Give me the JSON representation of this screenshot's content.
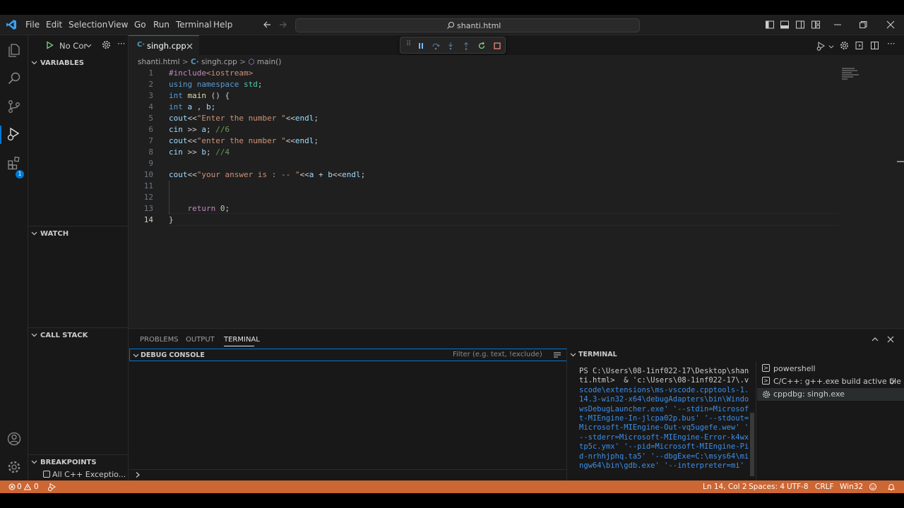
{
  "titlebar": {
    "menu": [
      "File",
      "Edit",
      "Selection",
      "View",
      "Go",
      "Run",
      "Terminal",
      "Help"
    ],
    "search_text": "shanti.html"
  },
  "sidebar": {
    "run_config": "No Cor",
    "sections": {
      "variables": "VARIABLES",
      "watch": "WATCH",
      "call_stack": "CALL STACK",
      "breakpoints": "BREAKPOINTS"
    },
    "breakpoint_item": "All C++ Exceptio...",
    "debug_badge": "1"
  },
  "editor": {
    "tab_label": "singh.cpp",
    "breadcrumb": {
      "folder": "shanti.html",
      "file": "singh.cpp",
      "symbol": "main()"
    },
    "line_numbers": [
      "1",
      "2",
      "3",
      "4",
      "5",
      "6",
      "7",
      "8",
      "9",
      "10",
      "11",
      "12",
      "13",
      "14"
    ],
    "current_line": "14"
  },
  "panel": {
    "tabs": [
      "PROBLEMS",
      "OUTPUT",
      "TERMINAL"
    ],
    "debug_console_title": "DEBUG CONSOLE",
    "filter_placeholder": "Filter (e.g. text, !exclude)",
    "terminal_title": "TERMINAL",
    "terminal_lines": [
      "PS C:\\Users\\08-1inf022-17\\Desktop\\shan",
      "ti.html>  & 'c:\\Users\\08-1inf022-17\\.v",
      "scode\\extensions\\ms-vscode.cpptools-1.",
      "14.3-win32-x64\\debugAdapters\\bin\\Windo",
      "wsDebugLauncher.exe' '--stdin=Microsof",
      "t-MIEngine-In-jlcpa02p.bus' '--stdout=",
      "Microsoft-MIEngine-Out-vq5ugefe.wew' '",
      "--stderr=Microsoft-MIEngine-Error-k4wx",
      "tp5c.ymx' '--pid=Microsoft-MIEngine-Pi",
      "d-nrhhjphq.ta5' '--dbgExe=C:\\msys64\\mi",
      "ngw64\\bin\\gdb.exe' '--interpreter=mi'"
    ],
    "terminal_list": [
      "powershell",
      "C/C++: g++.exe build active file",
      "cppdbg: singh.exe"
    ]
  },
  "statusbar": {
    "errors": "0",
    "warnings": "0",
    "position": "Ln 14, Col 2",
    "spaces": "Spaces: 4",
    "encoding": "UTF-8",
    "eol": "CRLF",
    "platform": "Win32"
  },
  "colors": {
    "accent": "#0078d4",
    "statusbar_debug": "#cc6633",
    "editor_bg": "#1f1f1f",
    "sidebar_bg": "#181818"
  }
}
